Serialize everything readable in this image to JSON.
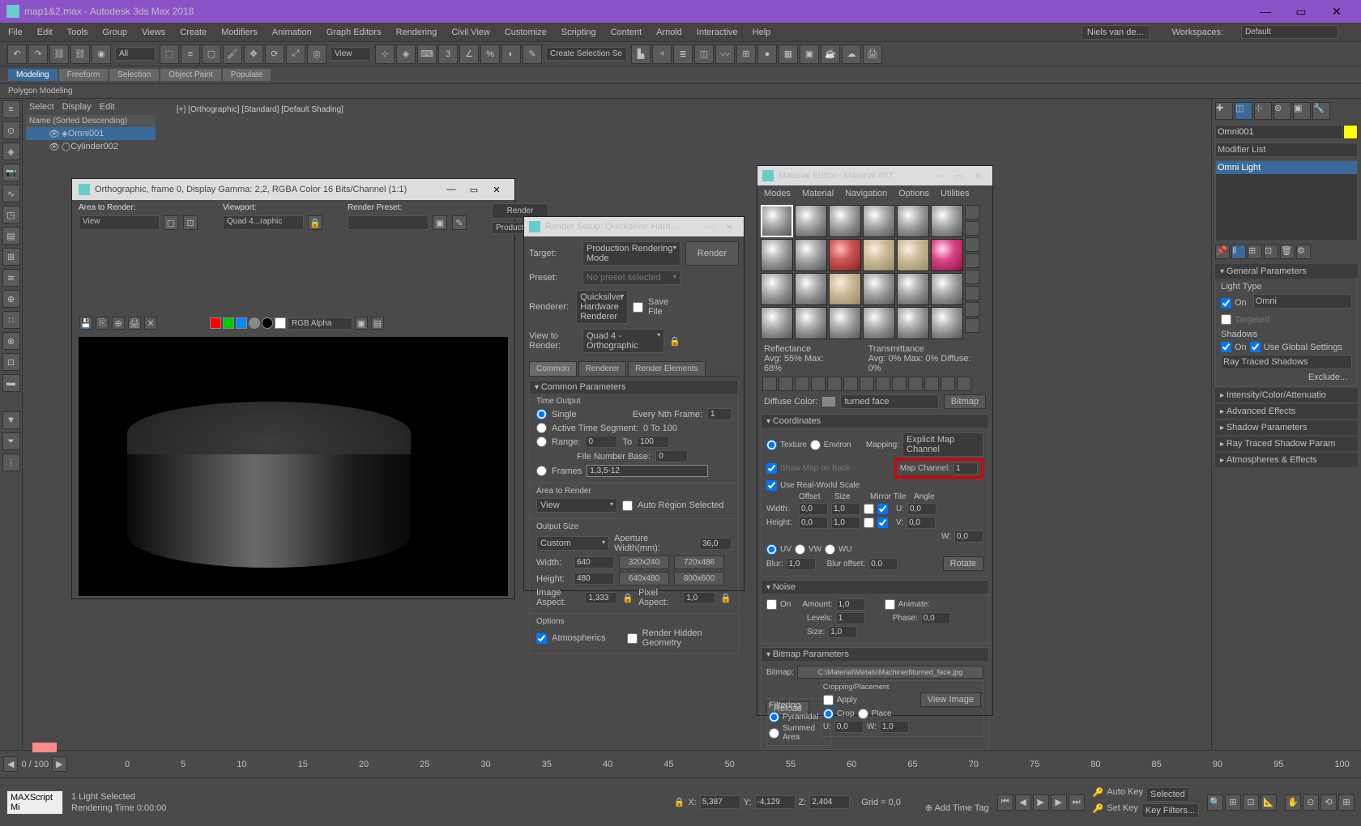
{
  "titlebar": {
    "title": "map1&2.max - Autodesk 3ds Max 2018"
  },
  "menu": [
    "File",
    "Edit",
    "Tools",
    "Group",
    "Views",
    "Create",
    "Modifiers",
    "Animation",
    "Graph Editors",
    "Rendering",
    "Civil View",
    "Customize",
    "Scripting",
    "Content",
    "Arnold",
    "Interactive",
    "Help"
  ],
  "user": "Niels van de...",
  "workspace_label": "Workspaces:",
  "workspace_value": "Default",
  "toolbar_sel": "All",
  "createsel": "Create Selection Se",
  "createsel2": "▾",
  "ribbon": {
    "tabs": [
      "Modeling",
      "Freeform",
      "Selection",
      "Object Paint",
      "Populate"
    ],
    "active": 0
  },
  "subribbon": "Polygon Modeling",
  "scene": {
    "hdr": [
      "Select",
      "Display",
      "Edit"
    ],
    "listhdr": "Name (Sorted Descending)",
    "items": [
      "Omni001",
      "Cylinder002"
    ],
    "sel": 0
  },
  "vp_label": "[+] [Orthographic] [Standard] [Default Shading]",
  "renderframe": {
    "title": "Orthographic, frame 0, Display Gamma: 2,2, RGBA Color 16 Bits/Channel (1:1)",
    "area_lbl": "Area to Render:",
    "area_val": "View",
    "vp_lbl": "Viewport:",
    "vp_val": "Quad 4...raphic",
    "preset_lbl": "Render Preset:",
    "preset_val": "",
    "render_btn": "Render",
    "prod_val": "Production",
    "chan_val": "RGB Alpha"
  },
  "rendersetup": {
    "title": "Render Setup: Quicksilver Hard...",
    "target_lbl": "Target:",
    "target_val": "Production Rendering Mode",
    "preset_lbl": "Preset:",
    "preset_val": "No preset selected",
    "renderer_lbl": "Renderer:",
    "renderer_val": "Quicksilver Hardware Renderer",
    "savefile_lbl": "Save File",
    "view_lbl": "View to Render:",
    "view_val": "Quad 4 - Orthographic",
    "render_btn": "Render",
    "tabs": [
      "Common",
      "Renderer",
      "Render Elements"
    ],
    "common_hdr": "Common Parameters",
    "time_hdr": "Time Output",
    "time_single": "Single",
    "time_nth": "Every Nth Frame:",
    "time_nth_v": "1",
    "time_active": "Active Time Segment:",
    "time_active_v": "0 To 100",
    "time_range": "Range:",
    "time_range_a": "0",
    "time_to": "To",
    "time_range_b": "100",
    "time_fnb": "File Number Base:",
    "time_fnb_v": "0",
    "time_frames": "Frames",
    "time_frames_v": "1,3,5-12",
    "area_hdr": "Area to Render",
    "area_val": "View",
    "area_auto": "Auto Region Selected",
    "size_hdr": "Output Size",
    "size_custom": "Custom",
    "size_ap_lbl": "Aperture Width(mm):",
    "size_ap_v": "36,0",
    "size_w_lbl": "Width:",
    "size_w_v": "640",
    "size_h_lbl": "Height:",
    "size_h_v": "480",
    "sizes": [
      "320x240",
      "720x486",
      "640x480",
      "800x600"
    ],
    "aspect_lbl": "Image Aspect:",
    "aspect_v": "1,333",
    "paspect_lbl": "Pixel Aspect:",
    "paspect_v": "1,0",
    "opt_hdr": "Options",
    "opt_atm": "Atmospherics",
    "opt_rhg": "Render Hidden Geometry"
  },
  "mateditor": {
    "title": "Material Editor - Material #67",
    "menu": [
      "Modes",
      "Material",
      "Navigation",
      "Options",
      "Utilities"
    ],
    "reflect_lbl": "Reflectance",
    "reflect_val": "Avg:  55% Max:  68%",
    "trans_lbl": "Transmittance",
    "trans_val": "Avg:   0% Max:   0%  Diffuse:   0%",
    "diffuse_lbl": "Diffuse Color:",
    "diffuse_val": "turned face",
    "bitmap_btn": "Bitmap",
    "coord_hdr": "Coordinates",
    "tex_lbl": "Texture",
    "env_lbl": "Environ",
    "mapping_lbl": "Mapping:",
    "mapping_val": "Explicit Map Channel",
    "showmap_lbl": "Show Map on Back",
    "mapch_lbl": "Map Channel:",
    "mapch_val": "1",
    "realworld_lbl": "Use Real-World Scale",
    "off_lbl": "Offset",
    "size_lbl": "Size",
    "mirror_lbl": "Mirror Tile",
    "angle_lbl": "Angle",
    "w_lbl": "Width:",
    "w_off": "0,0",
    "w_size": "1,0",
    "u_lbl": "U:",
    "u_ang": "0,0",
    "h_lbl": "Height:",
    "h_off": "0,0",
    "h_size": "1,0",
    "v_lbl": "V:",
    "v_ang": "0,0",
    "w2_lbl": "W:",
    "w2_ang": "0,0",
    "uv": "UV",
    "vw": "VW",
    "wu": "WU",
    "blur_lbl": "Blur:",
    "blur_v": "1,0",
    "bluroff_lbl": "Blur offset:",
    "bluroff_v": "0,0",
    "rotate_btn": "Rotate",
    "noise_hdr": "Noise",
    "noise_on": "On",
    "noise_amt_lbl": "Amount:",
    "noise_amt_v": "1,0",
    "noise_anim": "Animate:",
    "noise_lvl_lbl": "Levels:",
    "noise_lvl_v": "1",
    "noise_ph_lbl": "Phase:",
    "noise_ph_v": "0,0",
    "noise_sz_lbl": "Size:",
    "noise_sz_v": "1,0",
    "bmp_hdr": "Bitmap Parameters",
    "bmp_lbl": "Bitmap:",
    "bmp_path": "C:\\Material\\Metals\\Machined\\turned_face.jpg",
    "reload_btn": "Reload",
    "crop_hdr": "Cropping/Placement",
    "apply_lbl": "Apply",
    "viewimg_btn": "View Image",
    "filter_hdr": "Filtering",
    "pyr": "Pyramidal",
    "sum": "Summed Area",
    "crop_opt": "Crop",
    "place_opt": "Place",
    "crop_u": "U:",
    "crop_uv": "0,0",
    "crop_w": "W:",
    "crop_wv": "1,0"
  },
  "rightpanel": {
    "name": "Omni001",
    "modlist": "Modifier List",
    "stack": "Omni Light",
    "gp_hdr": "General Parameters",
    "lt_hdr": "Light Type",
    "lt_on": "On",
    "lt_val": "Omni",
    "lt_tgt": "Targeted",
    "sh_hdr": "Shadows",
    "sh_on": "On",
    "sh_glob": "Use Global Settings",
    "sh_val": "Ray Traced Shadows",
    "excl_btn": "Exclude...",
    "sections": [
      "Intensity/Color/Attenuatio",
      "Advanced Effects",
      "Shadow Parameters",
      "Ray Traced Shadow Param",
      "Atmospheres & Effects"
    ]
  },
  "timeline": {
    "pos": "0 / 100",
    "ticks": [
      "0",
      "5",
      "10",
      "15",
      "20",
      "25",
      "30",
      "35",
      "40",
      "45",
      "50",
      "55",
      "60",
      "65",
      "70",
      "75",
      "80",
      "85",
      "90",
      "95",
      "100"
    ]
  },
  "status": {
    "sel": "1 Light Selected",
    "time_lbl": "Rendering Time 0:00:00",
    "script": "MAXScript Mi",
    "x_lbl": "X:",
    "x_v": "5,387",
    "y_lbl": "Y:",
    "y_v": "-4,129",
    "z_lbl": "Z:",
    "z_v": "2,404",
    "grid_lbl": "Grid = 0,0",
    "addtag": "Add Time Tag",
    "autokey": "Auto Key",
    "selected": "Selected",
    "setkey": "Set Key",
    "keyfilters": "Key Filters..."
  }
}
